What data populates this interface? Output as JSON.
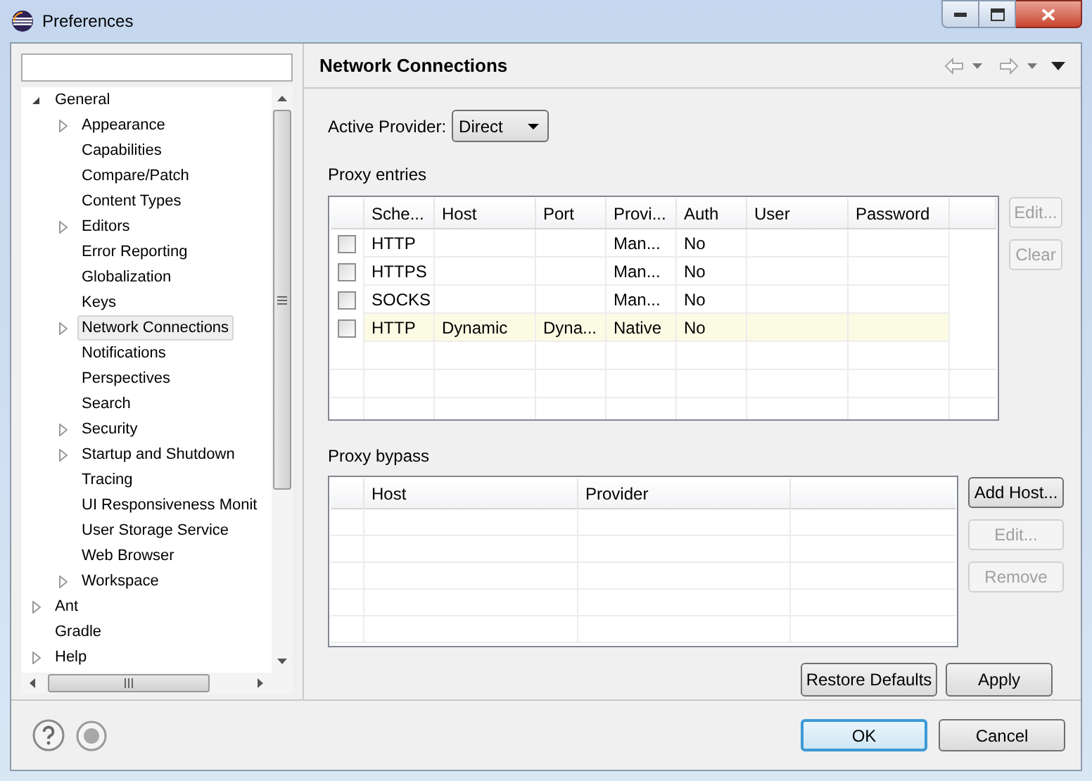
{
  "window": {
    "title": "Preferences"
  },
  "tree": [
    {
      "label": "General",
      "kind": "branch",
      "expanded": true,
      "selected": false,
      "children": [
        {
          "label": "Appearance",
          "kind": "branch",
          "expanded": false,
          "selected": false
        },
        {
          "label": "Capabilities",
          "kind": "leaf",
          "selected": false
        },
        {
          "label": "Compare/Patch",
          "kind": "leaf",
          "selected": false
        },
        {
          "label": "Content Types",
          "kind": "leaf",
          "selected": false
        },
        {
          "label": "Editors",
          "kind": "branch",
          "expanded": false,
          "selected": false
        },
        {
          "label": "Error Reporting",
          "kind": "leaf",
          "selected": false
        },
        {
          "label": "Globalization",
          "kind": "leaf",
          "selected": false
        },
        {
          "label": "Keys",
          "kind": "leaf",
          "selected": false
        },
        {
          "label": "Network Connections",
          "kind": "branch",
          "expanded": false,
          "selected": true
        },
        {
          "label": "Notifications",
          "kind": "leaf",
          "selected": false
        },
        {
          "label": "Perspectives",
          "kind": "leaf",
          "selected": false
        },
        {
          "label": "Search",
          "kind": "leaf",
          "selected": false
        },
        {
          "label": "Security",
          "kind": "branch",
          "expanded": false,
          "selected": false
        },
        {
          "label": "Startup and Shutdown",
          "kind": "branch",
          "expanded": false,
          "selected": false
        },
        {
          "label": "Tracing",
          "kind": "leaf",
          "selected": false
        },
        {
          "label": "UI Responsiveness Monit",
          "kind": "leaf",
          "selected": false
        },
        {
          "label": "User Storage Service",
          "kind": "leaf",
          "selected": false
        },
        {
          "label": "Web Browser",
          "kind": "leaf",
          "selected": false
        },
        {
          "label": "Workspace",
          "kind": "branch",
          "expanded": false,
          "selected": false
        }
      ]
    },
    {
      "label": "Ant",
      "kind": "branch",
      "expanded": false,
      "selected": false
    },
    {
      "label": "Gradle",
      "kind": "leaf",
      "selected": false
    },
    {
      "label": "Help",
      "kind": "branch",
      "expanded": false,
      "selected": false
    }
  ],
  "page": {
    "title": "Network Connections",
    "active_provider": {
      "label": "Active Provider:",
      "value": "Direct"
    },
    "proxy_entries": {
      "label": "Proxy entries",
      "columns": [
        "Sche...",
        "Host",
        "Port",
        "Provi...",
        "Auth",
        "User",
        "Password"
      ],
      "rows": [
        {
          "checked": false,
          "highlighted": false,
          "cells": [
            "HTTP",
            null,
            null,
            "Man...",
            "No",
            null,
            null
          ]
        },
        {
          "checked": false,
          "highlighted": false,
          "cells": [
            "HTTPS",
            null,
            null,
            "Man...",
            "No",
            null,
            null
          ]
        },
        {
          "checked": false,
          "highlighted": false,
          "cells": [
            "SOCKS",
            null,
            null,
            "Man...",
            "No",
            null,
            null
          ]
        },
        {
          "checked": false,
          "highlighted": true,
          "cells": [
            "HTTP",
            "Dynamic",
            "Dyna...",
            "Native",
            "No",
            null,
            null
          ]
        }
      ],
      "buttons": [
        {
          "label": "Edit...",
          "disabled": true
        },
        {
          "label": "Clear",
          "disabled": true
        }
      ]
    },
    "proxy_bypass": {
      "label": "Proxy bypass",
      "columns": [
        "Host",
        "Provider"
      ],
      "buttons": [
        {
          "label": "Add Host...",
          "disabled": false
        },
        {
          "label": "Edit...",
          "disabled": true
        },
        {
          "label": "Remove",
          "disabled": true
        }
      ]
    },
    "buttons": [
      {
        "label": "Restore Defaults"
      },
      {
        "label": "Apply"
      }
    ]
  },
  "dialog_buttons": [
    {
      "label": "OK",
      "default": true
    },
    {
      "label": "Cancel",
      "default": false
    }
  ]
}
